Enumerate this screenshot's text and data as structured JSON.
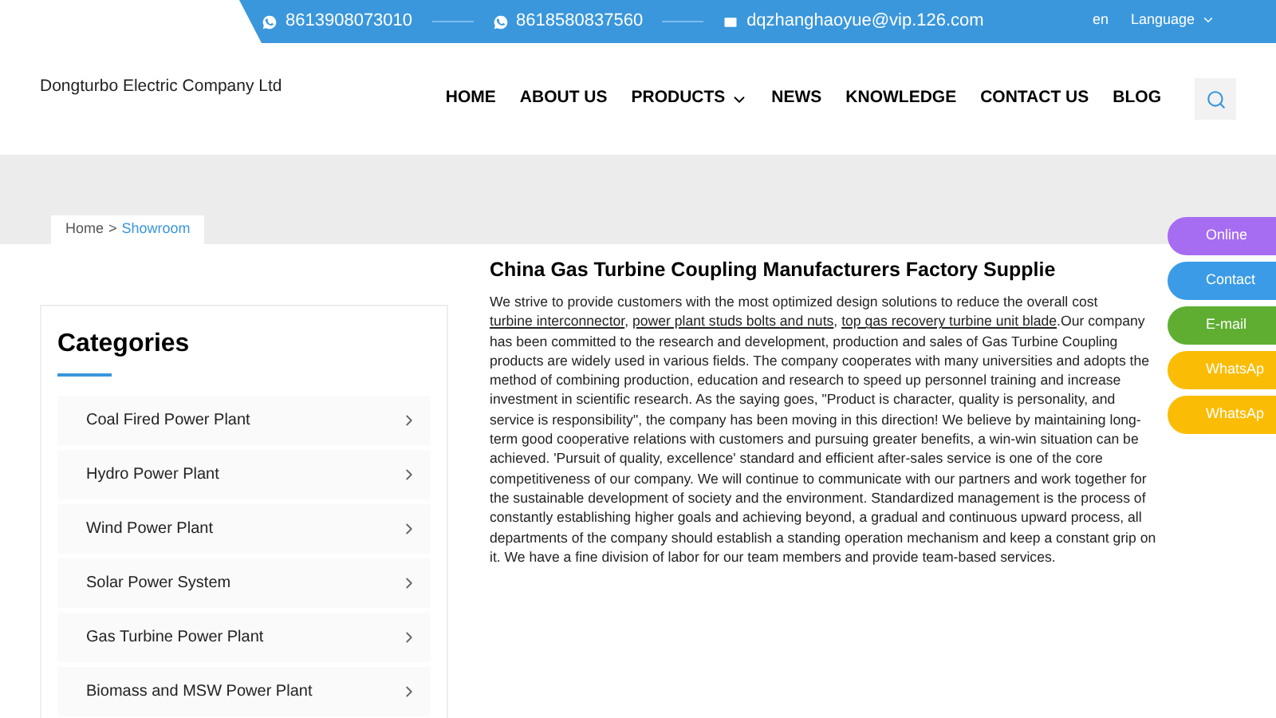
{
  "topbar": {
    "contacts": [
      {
        "kind": "whatsapp",
        "text": "8613908073010"
      },
      {
        "kind": "whatsapp",
        "text": "8618580837560"
      },
      {
        "kind": "email",
        "text": "dqzhanghaoyue@vip.126.com"
      }
    ],
    "lang_code": "en",
    "language": "Language"
  },
  "header": {
    "logo": "Dongturbo Electric Company Ltd",
    "nav": [
      {
        "label": "HOME",
        "dropdown": false
      },
      {
        "label": "ABOUT US",
        "dropdown": false
      },
      {
        "label": "PRODUCTS",
        "dropdown": true
      },
      {
        "label": "NEWS",
        "dropdown": false
      },
      {
        "label": "KNOWLEDGE",
        "dropdown": false
      },
      {
        "label": "CONTACT US",
        "dropdown": false
      },
      {
        "label": "BLOG",
        "dropdown": false
      }
    ]
  },
  "breadcrumb": {
    "home": "Home",
    "separator": ">",
    "current": "Showroom"
  },
  "sidebar": {
    "title": "Categories",
    "items": [
      "Coal Fired Power Plant",
      "Hydro Power Plant",
      "Wind Power Plant",
      "Solar Power System",
      "Gas Turbine Power Plant",
      "Biomass and MSW Power Plant"
    ]
  },
  "article": {
    "title": "China Gas Turbine Coupling Manufacturers Factory Supplie",
    "intro": "We strive to provide customers with the most optimized design solutions to reduce the overall cost",
    "links": [
      {
        "text": "turbine interconnector",
        "after": ", "
      },
      {
        "text": "power plant studs bolts and nuts",
        "after": ", "
      },
      {
        "text": "top gas recovery turbine unit blade",
        "after": "."
      }
    ],
    "body": "Our company has been committed to the research and development, production and sales of Gas Turbine Coupling products are widely used in various fields. The company cooperates with many universities and adopts the method of combining production, education and research to speed up personnel training and increase investment in scientific research. As the saying goes, \"Product is character, quality is personality, and service is responsibility\", the company has been moving in this direction! We believe by maintaining long-term good cooperative relations with customers and pursuing greater benefits, a win-win situation can be achieved. 'Pursuit of quality, excellence' standard and efficient after-sales service is one of the core competitiveness of our company. We will continue to communicate with our partners and work together for the sustainable development of society and the environment. Standardized management is the process of constantly establishing higher goals and achieving beyond, a gradual and continuous upward process, all departments of the company should establish a standing operation mechanism and keep a constant grip on it. We have a fine division of labor for our team members and provide team-based services."
  },
  "float_buttons": [
    {
      "label": "Online",
      "color": "#a66cf2"
    },
    {
      "label": "Contact",
      "color": "#3b9be6"
    },
    {
      "label": "E-mail",
      "color": "#5fae32"
    },
    {
      "label": "WhatsAp",
      "color": "#fbbc05"
    },
    {
      "label": "WhatsAp",
      "color": "#fbbc05"
    }
  ]
}
